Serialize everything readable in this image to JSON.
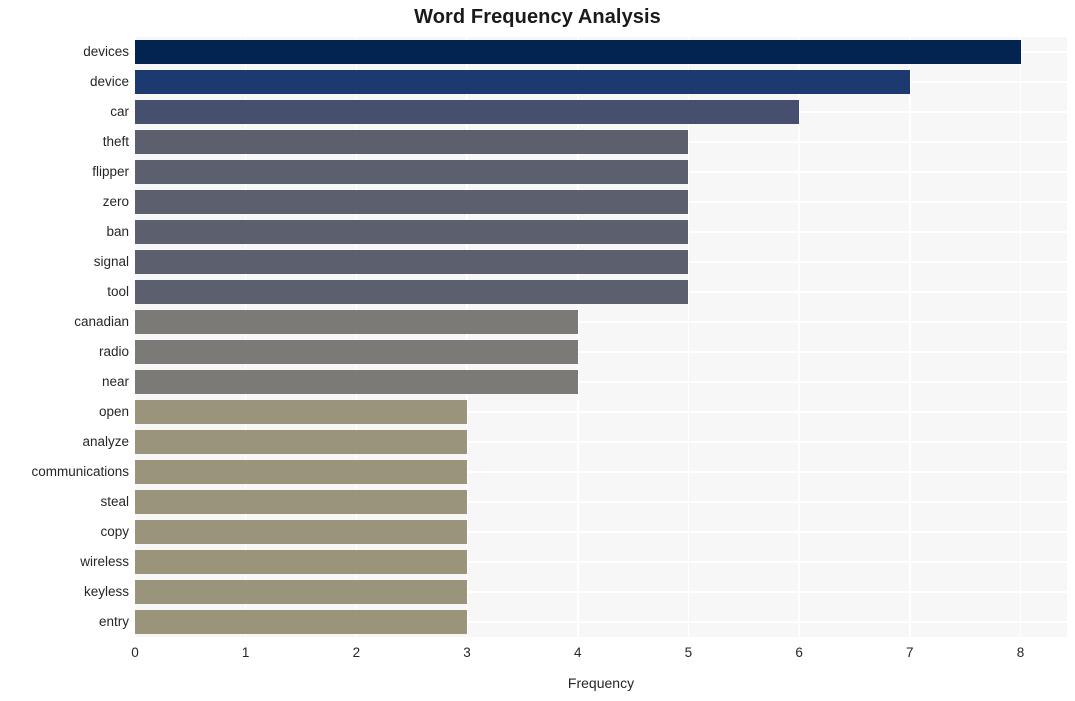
{
  "chart_data": {
    "type": "bar",
    "orientation": "horizontal",
    "title": "Word Frequency Analysis",
    "xlabel": "Frequency",
    "ylabel": "",
    "xlim": [
      0,
      8.42
    ],
    "xticks": [
      0,
      1,
      2,
      3,
      4,
      5,
      6,
      7,
      8
    ],
    "xtick_labels": [
      "0",
      "1",
      "2",
      "3",
      "4",
      "5",
      "6",
      "7",
      "8"
    ],
    "grid": true,
    "grid_color": "#ffffff",
    "plot_background": "#f7f7f8",
    "figure_background": "#ffffff",
    "legend": null,
    "categories": [
      "devices",
      "device",
      "car",
      "theft",
      "flipper",
      "zero",
      "ban",
      "signal",
      "tool",
      "canadian",
      "radio",
      "near",
      "open",
      "analyze",
      "communications",
      "steal",
      "copy",
      "wireless",
      "keyless",
      "entry"
    ],
    "values": [
      8,
      7,
      6,
      5,
      5,
      5,
      5,
      5,
      5,
      4,
      4,
      4,
      3,
      3,
      3,
      3,
      3,
      3,
      3,
      3
    ],
    "bar_colors": [
      "#032450",
      "#1d3a70",
      "#464f6e",
      "#5c5f6d",
      "#5c5f6d",
      "#5c5f6d",
      "#5c5f6d",
      "#5c5f6d",
      "#5c5f6d",
      "#7b7a77",
      "#7b7a77",
      "#7b7a77",
      "#99947a",
      "#99947a",
      "#99947a",
      "#99947a",
      "#99947a",
      "#99947a",
      "#99947a",
      "#99947a"
    ]
  }
}
